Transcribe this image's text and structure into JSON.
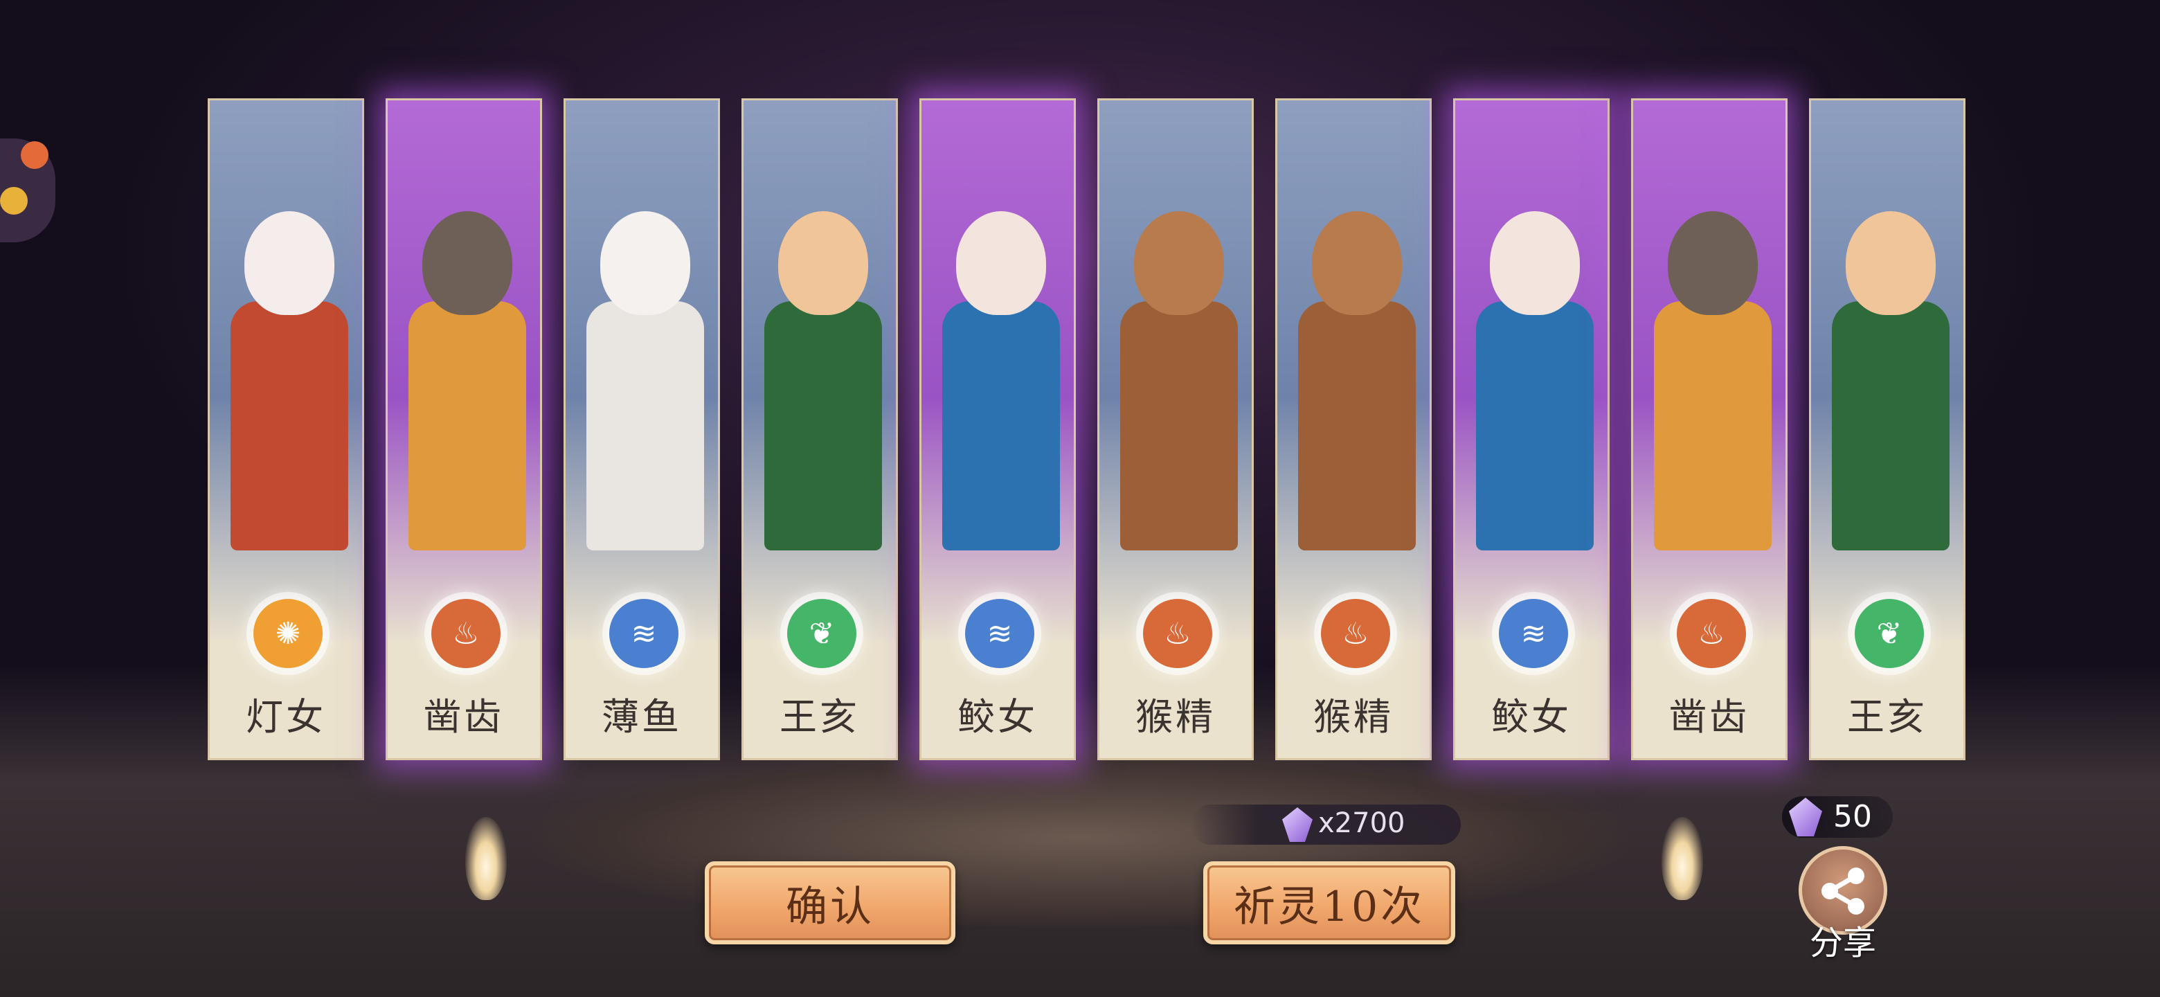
{
  "cards": [
    {
      "name": "灯女",
      "element": "light-icon",
      "frame": "blue",
      "skin": "#f5ecec",
      "outfit": "#c24a30"
    },
    {
      "name": "凿齿",
      "element": "fire-icon",
      "frame": "purple",
      "skin": "#6e6057",
      "outfit": "#e09a3c"
    },
    {
      "name": "薄鱼",
      "element": "water-icon",
      "frame": "blue",
      "skin": "#f4f1ee",
      "outfit": "#e9e6e2"
    },
    {
      "name": "王亥",
      "element": "wood-icon",
      "frame": "blue",
      "skin": "#f0c59a",
      "outfit": "#2f6a3a"
    },
    {
      "name": "鲛女",
      "element": "water-icon",
      "frame": "purple",
      "skin": "#f3e4dd",
      "outfit": "#2c72b0"
    },
    {
      "name": "猴精",
      "element": "fire-icon",
      "frame": "blue",
      "skin": "#b77b4d",
      "outfit": "#9c5f37"
    },
    {
      "name": "猴精",
      "element": "fire-icon",
      "frame": "blue",
      "skin": "#b77b4d",
      "outfit": "#9c5f37"
    },
    {
      "name": "鲛女",
      "element": "water-icon",
      "frame": "purple",
      "skin": "#f3e4dd",
      "outfit": "#2c72b0"
    },
    {
      "name": "凿齿",
      "element": "fire-icon",
      "frame": "purple",
      "skin": "#6e6057",
      "outfit": "#e09a3c"
    },
    {
      "name": "王亥",
      "element": "wood-icon",
      "frame": "blue",
      "skin": "#f0c59a",
      "outfit": "#2f6a3a"
    }
  ],
  "cost": {
    "text": "x2700"
  },
  "buttons": {
    "confirm": "确认",
    "pray": "祈灵10次"
  },
  "currency": {
    "amount": "50"
  },
  "share": {
    "label": "分享"
  }
}
